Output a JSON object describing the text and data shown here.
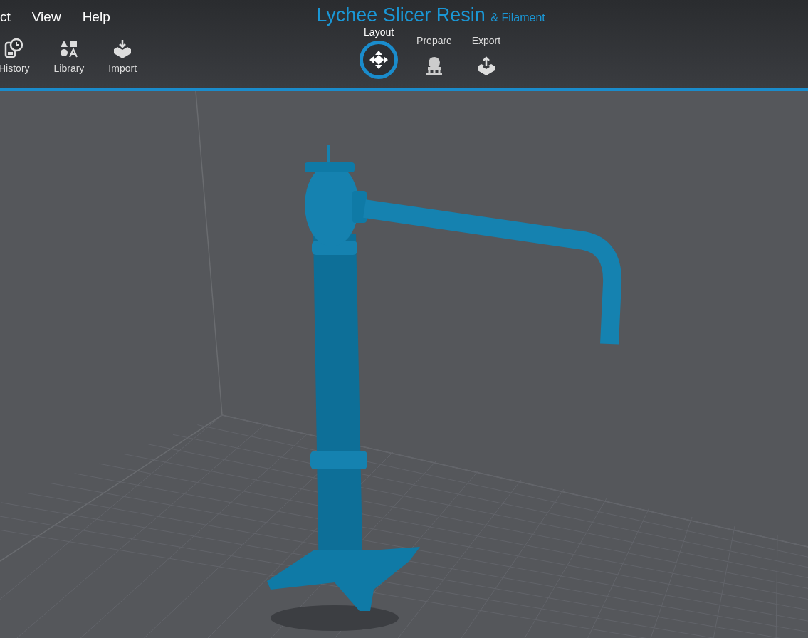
{
  "menu": [
    "ct",
    "View",
    "Help"
  ],
  "toolbar": [
    {
      "label": "History",
      "kind": "history"
    },
    {
      "label": "Library",
      "kind": "library"
    },
    {
      "label": "Import",
      "kind": "import"
    }
  ],
  "title": {
    "main": "Lychee Slicer Resin",
    "suffix": "& Filament"
  },
  "modes": [
    {
      "label": "Layout",
      "kind": "move",
      "selected": true
    },
    {
      "label": "Prepare",
      "kind": "support",
      "selected": false
    },
    {
      "label": "Export",
      "kind": "export",
      "selected": false
    }
  ]
}
